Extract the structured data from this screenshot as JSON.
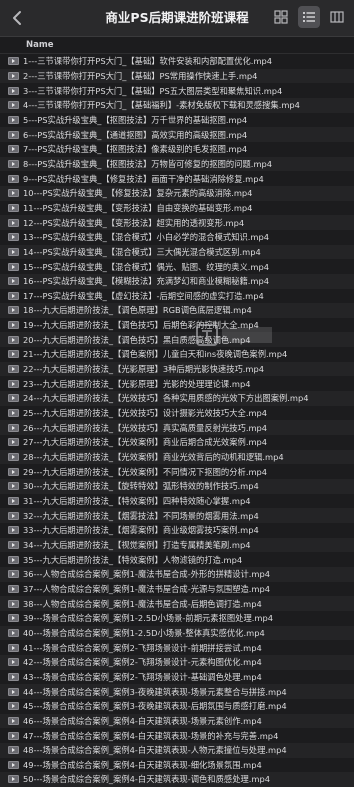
{
  "window": {
    "title": "商业PS后期课进阶班课程"
  },
  "toolbar": {
    "icons": [
      "back-arrow-icon",
      "grid-view-icon",
      "list-view-icon",
      "column-view-icon"
    ]
  },
  "table": {
    "column_name": "Name"
  },
  "files": [
    "1---三节课带你打开PS大门_【基础】软件安装和内部配置优化.mp4",
    "2---三节课带你打开PS大门_【基础】PS常用操作快速上手.mp4",
    "3---三节课带你打开PS大门_【基础】PS五大图层类型和聚焦知识.mp4",
    "4---三节课带你打开PS大门_【基础福利】-素材免版权下载和灵感搜集.mp4",
    "5---PS实战升级宝典_【抠图技法】万千世界的基础抠图.mp4",
    "6---PS实战升级宝典_【通道抠图】高效实用的高级抠图.mp4",
    "7---PS实战升级宝典_【抠图技法】像素级别的毛发抠图.mp4",
    "8---PS实战升级宝典_【抠图技法】万物皆可修复的抠图的问题.mp4",
    "9---PS实战升级宝典_【修复技法】画面干净的基础消除修复.mp4",
    "10---PS实战升级宝典_【修复技法】复杂元素的高级消除.mp4",
    "11---PS实战升级宝典_【变形技法】自由变换的基础变形.mp4",
    "12---PS实战升级宝典_【变形技法】超实用的透视变形.mp4",
    "13---PS实战升级宝典_【混合模式】小白必学的混合模式知识.mp4",
    "14---PS实战升级宝典_【混合模式】三大偶光混合模式区别.mp4",
    "15---PS实战升级宝典_【混合模式】偶光、贴图、纹理的奥义.mp4",
    "16---PS实战升级宝典_【模糊技法】充满梦幻和商业模糊秘籍.mp4",
    "17---PS实战升级宝典_【虚幻技法】-后期空间感的虚实打造.mp4",
    "18---九大后期进阶技法_【调色原理】RGB调色底层逻辑.mp4",
    "19---九大后期进阶技法_【调色技巧】后期色彩的控制大全.mp4",
    "20---九大后期进阶技法_【调色技巧】黑白质感高级调色.mp4",
    "21---九大后期进阶技法_【调色案例】儿童白天和ins夜晚调色案例.mp4",
    "22---九大后期进阶技法_【光影原理】3种后期光影快速技巧.mp4",
    "23---九大后期进阶技法_【光影原理】光影的处理理论课.mp4",
    "24---九大后期进阶技法_【光效技巧】各种实用质感的光效下方出图案例.mp4",
    "25---九大后期进阶技法_【光效技巧】设计摄影光效技巧大全.mp4",
    "26---九大后期进阶技法_【光效技巧】真实高质量反射光技巧.mp4",
    "27---九大后期进阶技法_【光效案例】商业后期合成光效案例.mp4",
    "28---九大后期进阶技法_【光效案例】商业光效背后的动机和逻辑.mp4",
    "29---九大后期进阶技法_【光效案例】不同情况下抠图的分析.mp4",
    "30---九大后期进阶技法_【旋转特效】弧形特效的制作技巧.mp4",
    "31---九大后期进阶技法_【特效案例】四种特效随心掌握.mp4",
    "32---九大后期进阶技法_【烟雾技法】不同场景的烟雾用法.mp4",
    "33---九大后期进阶技法_【烟雾案例】商业级烟雾技巧案例.mp4",
    "34---九大后期进阶技法_【视觉案例】打造专属精美笔刷.mp4",
    "35---九大后期进阶技法_【特效案例】人物滤镜的打造.mp4",
    "36---人物合成综合案例_案例1-魔法书屋合成-外形的拼精设计.mp4",
    "37---人物合成综合案例_案例1-魔法书屋合成-光源与氛围塑造.mp4",
    "38---人物合成综合案例_案例1-魔法书屋合成-后期色调打造.mp4",
    "39---场景合成综合案例_案例1-2.5D小场景-前期元素抠图处理.mp4",
    "40---场景合成综合案例_案例1-2.5D小场景-整体真实感优化.mp4",
    "41---场景合成综合案例_案例2-飞翔场景设计-前期拼接尝试.mp4",
    "42---场景合成综合案例_案例2-飞翔场景设计-元素构图优化.mp4",
    "43---场景合成综合案例_案例2-飞翔场景设计-基础调色处理.mp4",
    "44---场景合成综合案例_案例3-夜晚建筑表现-场景元素整合与拼接.mp4",
    "45---场景合成综合案例_案例3-夜晚建筑表现-后期氛围与质感打磨.mp4",
    "46---场景合成综合案例_案例4-白天建筑表现-场景元素创作.mp4",
    "47---场景合成综合案例_案例4-白天建筑表现-场景的补充与完善.mp4",
    "48---场景合成综合案例_案例4-白天建筑表现-人物元素撞位与处理.mp4",
    "49---场景合成综合案例_案例4-白天建筑表现-细化场景氛围.mp4",
    "50---场景合成综合案例_案例4-白天建筑表现-调色和质感处理.mp4"
  ]
}
